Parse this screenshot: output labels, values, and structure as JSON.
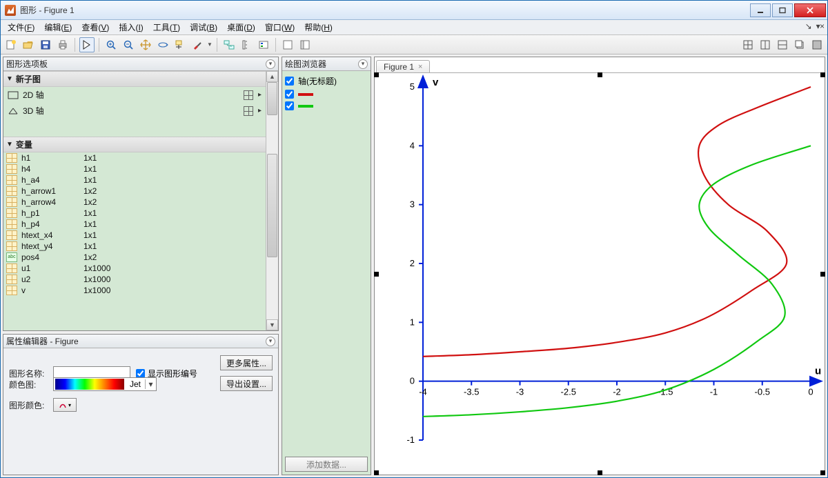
{
  "title": "图形 - Figure 1",
  "menus": [
    {
      "label": "文件",
      "acc": "F"
    },
    {
      "label": "编辑",
      "acc": "E"
    },
    {
      "label": "查看",
      "acc": "V"
    },
    {
      "label": "插入",
      "acc": "I"
    },
    {
      "label": "工具",
      "acc": "T"
    },
    {
      "label": "调试",
      "acc": "B"
    },
    {
      "label": "桌面",
      "acc": "D"
    },
    {
      "label": "窗口",
      "acc": "W"
    },
    {
      "label": "帮助",
      "acc": "H"
    }
  ],
  "palette": {
    "title": "图形选项板",
    "section_newsub": "新子图",
    "axes2d": "2D 轴",
    "axes3d": "3D 轴",
    "section_vars": "变量",
    "vars": [
      {
        "name": "h1",
        "size": "1x1",
        "t": "n"
      },
      {
        "name": "h4",
        "size": "1x1",
        "t": "n"
      },
      {
        "name": "h_a4",
        "size": "1x1",
        "t": "n"
      },
      {
        "name": "h_arrow1",
        "size": "1x2",
        "t": "n"
      },
      {
        "name": "h_arrow4",
        "size": "1x2",
        "t": "n"
      },
      {
        "name": "h_p1",
        "size": "1x1",
        "t": "n"
      },
      {
        "name": "h_p4",
        "size": "1x1",
        "t": "n"
      },
      {
        "name": "htext_x4",
        "size": "1x1",
        "t": "n"
      },
      {
        "name": "htext_y4",
        "size": "1x1",
        "t": "n"
      },
      {
        "name": "pos4",
        "size": "1x2",
        "t": "s"
      },
      {
        "name": "u1",
        "size": "1x1000",
        "t": "n"
      },
      {
        "name": "u2",
        "size": "1x1000",
        "t": "n"
      },
      {
        "name": "v",
        "size": "1x1000",
        "t": "n"
      }
    ]
  },
  "prop": {
    "title": "属性编辑器 - Figure",
    "name_label": "图形名称:",
    "name_value": "",
    "show_num": "显示图形编号",
    "more_btn": "更多属性...",
    "export_btn": "导出设置...",
    "colormap_label": "颜色图:",
    "colormap_name": "Jet",
    "figcolor_label": "图形颜色:"
  },
  "browser": {
    "title": "绘图浏览器",
    "axes_label": "轴(无标题)",
    "add_data": "添加数据..."
  },
  "figure_tab": "Figure 1",
  "chart_data": {
    "type": "line",
    "xlabel": "u",
    "ylabel": "v",
    "xlim": [
      -4,
      0
    ],
    "ylim": [
      -1,
      5
    ],
    "xticks": [
      -4,
      -3.5,
      -3,
      -2.5,
      -2,
      -1.5,
      -1,
      -0.5,
      0
    ],
    "yticks": [
      -1,
      0,
      1,
      2,
      3,
      4,
      5
    ],
    "series": [
      {
        "name": "red",
        "color": "#d01010",
        "points": [
          [
            -4,
            0.42
          ],
          [
            -3.5,
            0.45
          ],
          [
            -3,
            0.5
          ],
          [
            -2.5,
            0.56
          ],
          [
            -2,
            0.66
          ],
          [
            -1.5,
            0.82
          ],
          [
            -1.05,
            1.1
          ],
          [
            -0.6,
            1.55
          ],
          [
            -0.25,
            2.0
          ],
          [
            -0.45,
            2.55
          ],
          [
            -0.85,
            3.0
          ],
          [
            -1.1,
            3.5
          ],
          [
            -1.15,
            4.0
          ],
          [
            -0.95,
            4.35
          ],
          [
            -0.55,
            4.65
          ],
          [
            0,
            5.0
          ]
        ]
      },
      {
        "name": "green",
        "color": "#10c810",
        "points": [
          [
            -4,
            -0.6
          ],
          [
            -3.5,
            -0.57
          ],
          [
            -3,
            -0.52
          ],
          [
            -2.5,
            -0.45
          ],
          [
            -2,
            -0.34
          ],
          [
            -1.5,
            -0.15
          ],
          [
            -1.0,
            0.2
          ],
          [
            -0.55,
            0.68
          ],
          [
            -0.27,
            1.1
          ],
          [
            -0.4,
            1.65
          ],
          [
            -0.75,
            2.15
          ],
          [
            -1.05,
            2.6
          ],
          [
            -1.15,
            3.0
          ],
          [
            -1.0,
            3.35
          ],
          [
            -0.6,
            3.68
          ],
          [
            0,
            4.0
          ]
        ]
      }
    ]
  }
}
